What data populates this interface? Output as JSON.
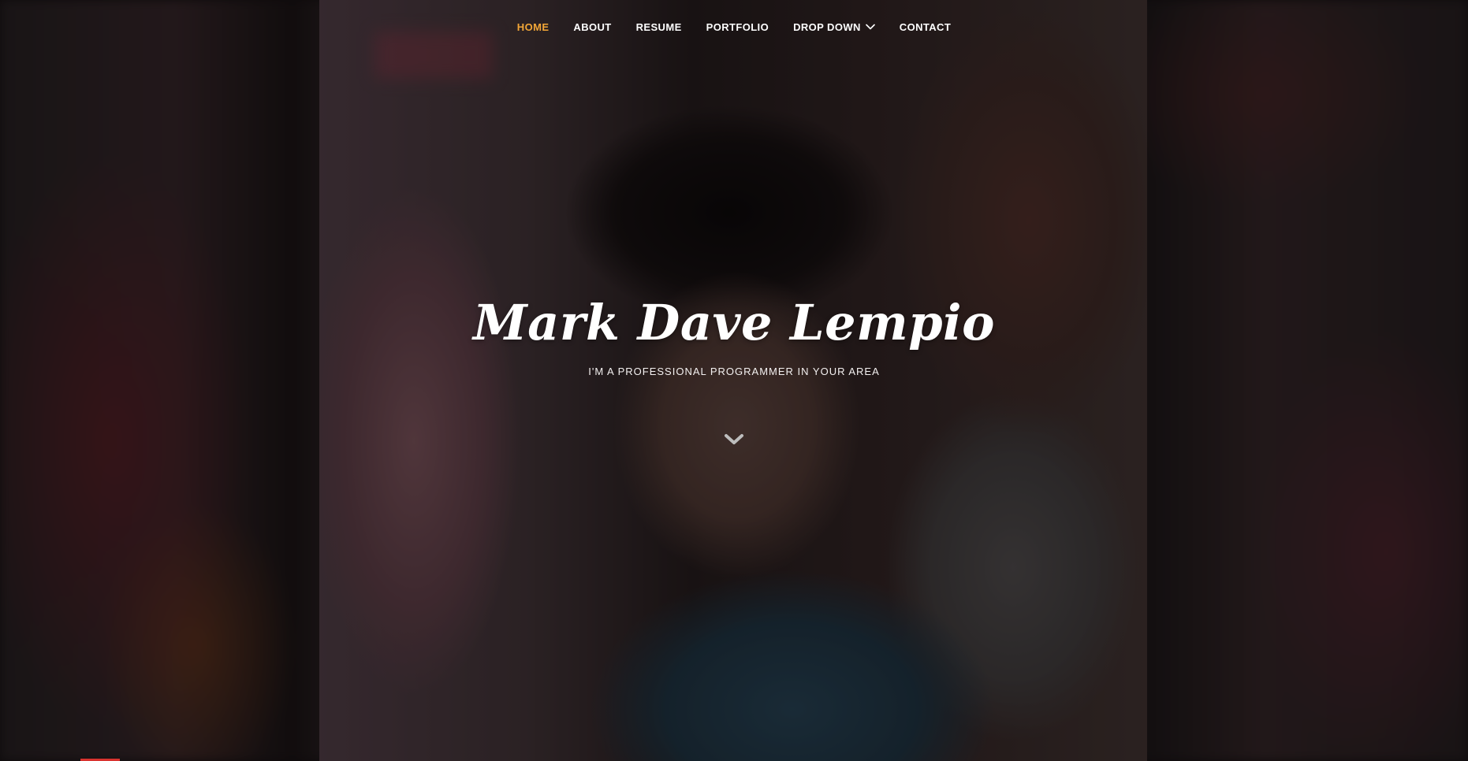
{
  "nav": {
    "items": [
      {
        "label": "HOME",
        "active": true
      },
      {
        "label": "ABOUT",
        "active": false
      },
      {
        "label": "RESUME",
        "active": false
      },
      {
        "label": "PORTFOLIO",
        "active": false
      },
      {
        "label": "DROP DOWN",
        "active": false,
        "dropdown": true
      },
      {
        "label": "CONTACT",
        "active": false
      }
    ],
    "active_color": "#f2a637",
    "text_color": "#ffffff"
  },
  "hero": {
    "name": "Mark Dave Lempio",
    "tagline": "I'M A PROFESSIONAL PROGRAMMER IN YOUR AREA"
  },
  "icons": {
    "dropdown": "chevron-down-icon",
    "scroll": "chevron-down-icon"
  },
  "colors": {
    "accent": "#f2a637",
    "bottom_accent": "#d9332f"
  }
}
